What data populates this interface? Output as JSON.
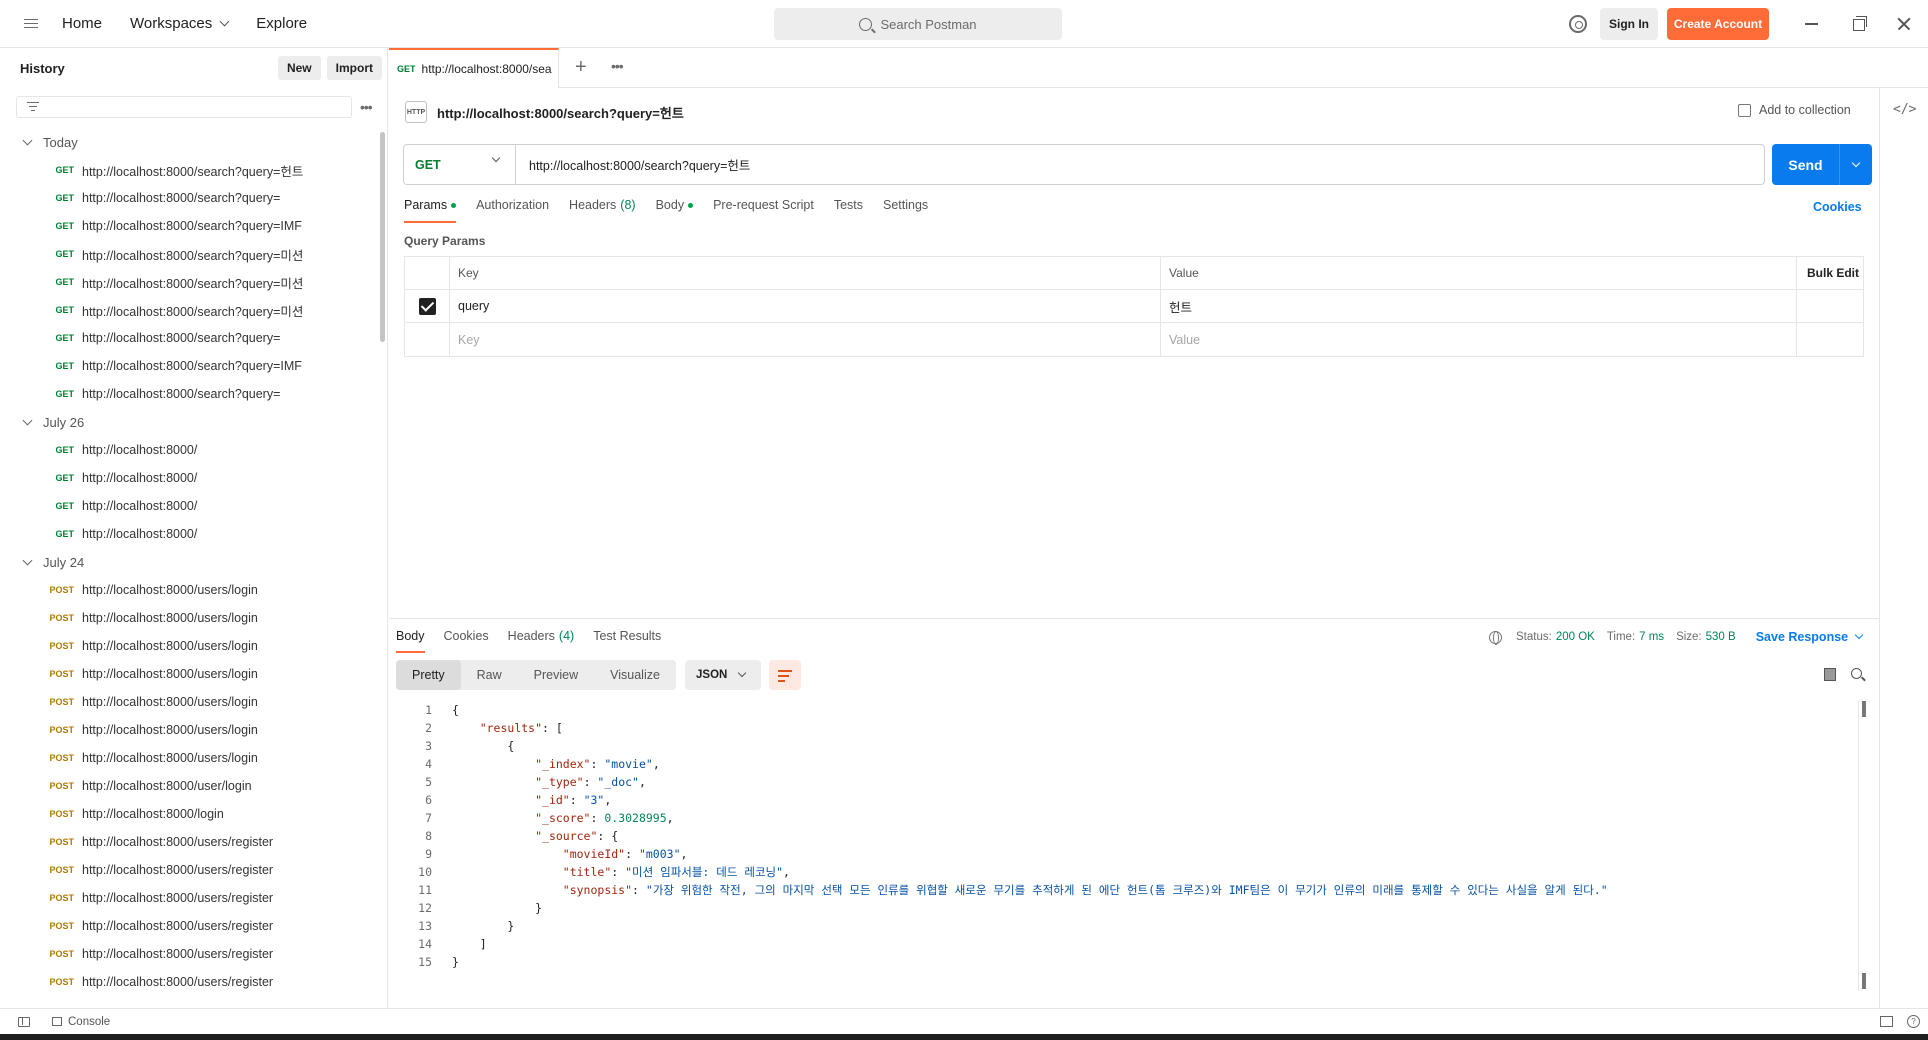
{
  "topbar": {
    "nav": [
      "Home",
      "Workspaces",
      "Explore"
    ],
    "search_placeholder": "Search Postman",
    "signin": "Sign In",
    "create_account": "Create Account"
  },
  "sidebar": {
    "title": "History",
    "new_label": "New",
    "import_label": "Import",
    "groups": [
      {
        "label": "Today",
        "items": [
          {
            "method": "GET",
            "url": "http://localhost:8000/search?query=헌트"
          },
          {
            "method": "GET",
            "url": "http://localhost:8000/search?query="
          },
          {
            "method": "GET",
            "url": "http://localhost:8000/search?query=IMF"
          },
          {
            "method": "GET",
            "url": "http://localhost:8000/search?query=미션"
          },
          {
            "method": "GET",
            "url": "http://localhost:8000/search?query=미션"
          },
          {
            "method": "GET",
            "url": "http://localhost:8000/search?query=미션"
          },
          {
            "method": "GET",
            "url": "http://localhost:8000/search?query="
          },
          {
            "method": "GET",
            "url": "http://localhost:8000/search?query=IMF"
          },
          {
            "method": "GET",
            "url": "http://localhost:8000/search?query="
          }
        ]
      },
      {
        "label": "July 26",
        "items": [
          {
            "method": "GET",
            "url": "http://localhost:8000/"
          },
          {
            "method": "GET",
            "url": "http://localhost:8000/"
          },
          {
            "method": "GET",
            "url": "http://localhost:8000/"
          },
          {
            "method": "GET",
            "url": "http://localhost:8000/"
          }
        ]
      },
      {
        "label": "July 24",
        "items": [
          {
            "method": "POST",
            "url": "http://localhost:8000/users/login"
          },
          {
            "method": "POST",
            "url": "http://localhost:8000/users/login"
          },
          {
            "method": "POST",
            "url": "http://localhost:8000/users/login"
          },
          {
            "method": "POST",
            "url": "http://localhost:8000/users/login"
          },
          {
            "method": "POST",
            "url": "http://localhost:8000/users/login"
          },
          {
            "method": "POST",
            "url": "http://localhost:8000/users/login"
          },
          {
            "method": "POST",
            "url": "http://localhost:8000/users/login"
          },
          {
            "method": "POST",
            "url": "http://localhost:8000/user/login"
          },
          {
            "method": "POST",
            "url": "http://localhost:8000/login"
          },
          {
            "method": "POST",
            "url": "http://localhost:8000/users/register"
          },
          {
            "method": "POST",
            "url": "http://localhost:8000/users/register"
          },
          {
            "method": "POST",
            "url": "http://localhost:8000/users/register"
          },
          {
            "method": "POST",
            "url": "http://localhost:8000/users/register"
          },
          {
            "method": "POST",
            "url": "http://localhost:8000/users/register"
          },
          {
            "method": "POST",
            "url": "http://localhost:8000/users/register"
          }
        ]
      }
    ]
  },
  "tab": {
    "method": "GET",
    "label": "http://localhost:8000/sea"
  },
  "request": {
    "title": "http://localhost:8000/search?query=헌트",
    "http_badge": "HTTP",
    "add_to_collection": "Add to collection",
    "method": "GET",
    "url": "http://localhost:8000/search?query=헌트",
    "send": "Send",
    "tabs": {
      "params": "Params",
      "authorization": "Authorization",
      "headers": "Headers",
      "headers_count": "(8)",
      "body": "Body",
      "prerequest": "Pre-request Script",
      "tests": "Tests",
      "settings": "Settings"
    },
    "cookies": "Cookies",
    "query_params_title": "Query Params",
    "table": {
      "key_header": "Key",
      "value_header": "Value",
      "bulk_edit": "Bulk Edit",
      "row": {
        "key": "query",
        "value": "헌트"
      },
      "key_placeholder": "Key",
      "value_placeholder": "Value"
    }
  },
  "response": {
    "tabs": {
      "body": "Body",
      "cookies": "Cookies",
      "headers": "Headers",
      "headers_count": "(4)",
      "test_results": "Test Results"
    },
    "status_label": "Status:",
    "status_value": "200 OK",
    "time_label": "Time:",
    "time_value": "7 ms",
    "size_label": "Size:",
    "size_value": "530 B",
    "save_response": "Save Response",
    "views": [
      "Pretty",
      "Raw",
      "Preview",
      "Visualize"
    ],
    "format": "JSON",
    "body_lines": [
      {
        "indent": 0,
        "parts": [
          [
            "p",
            "{"
          ]
        ]
      },
      {
        "indent": 1,
        "parts": [
          [
            "k",
            "\"results\""
          ],
          [
            "p",
            ": ["
          ]
        ]
      },
      {
        "indent": 2,
        "parts": [
          [
            "p",
            "{"
          ]
        ]
      },
      {
        "indent": 3,
        "parts": [
          [
            "k",
            "\"_index\""
          ],
          [
            "p",
            ": "
          ],
          [
            "s",
            "\"movie\""
          ],
          [
            "p",
            ","
          ]
        ]
      },
      {
        "indent": 3,
        "parts": [
          [
            "k",
            "\"_type\""
          ],
          [
            "p",
            ": "
          ],
          [
            "s",
            "\"_doc\""
          ],
          [
            "p",
            ","
          ]
        ]
      },
      {
        "indent": 3,
        "parts": [
          [
            "k",
            "\"_id\""
          ],
          [
            "p",
            ": "
          ],
          [
            "s",
            "\"3\""
          ],
          [
            "p",
            ","
          ]
        ]
      },
      {
        "indent": 3,
        "parts": [
          [
            "k",
            "\"_score\""
          ],
          [
            "p",
            ": "
          ],
          [
            "n",
            "0.3028995"
          ],
          [
            "p",
            ","
          ]
        ]
      },
      {
        "indent": 3,
        "parts": [
          [
            "k",
            "\"_source\""
          ],
          [
            "p",
            ": {"
          ]
        ]
      },
      {
        "indent": 4,
        "parts": [
          [
            "k",
            "\"movieId\""
          ],
          [
            "p",
            ": "
          ],
          [
            "s",
            "\"m003\""
          ],
          [
            "p",
            ","
          ]
        ]
      },
      {
        "indent": 4,
        "parts": [
          [
            "k",
            "\"title\""
          ],
          [
            "p",
            ": "
          ],
          [
            "s",
            "\"미션 임파서블: 데드 레코닝\""
          ],
          [
            "p",
            ","
          ]
        ]
      },
      {
        "indent": 4,
        "parts": [
          [
            "k",
            "\"synopsis\""
          ],
          [
            "p",
            ": "
          ],
          [
            "s",
            "\"가장 위험한 작전, 그의 마지막 선택 모든 인류를 위협할 새로운 무기를 추적하게 된 에단 헌트(톰 크루즈)와 IMF팀은 이 무기가 인류의 미래를 통제할 수 있다는 사실을 알게 된다.\""
          ]
        ]
      },
      {
        "indent": 3,
        "parts": [
          [
            "p",
            "}"
          ]
        ]
      },
      {
        "indent": 2,
        "parts": [
          [
            "p",
            "}"
          ]
        ]
      },
      {
        "indent": 1,
        "parts": [
          [
            "p",
            "]"
          ]
        ]
      },
      {
        "indent": 0,
        "parts": [
          [
            "p",
            "}"
          ]
        ]
      }
    ]
  },
  "statusbar": {
    "console": "Console",
    "help": "?"
  }
}
